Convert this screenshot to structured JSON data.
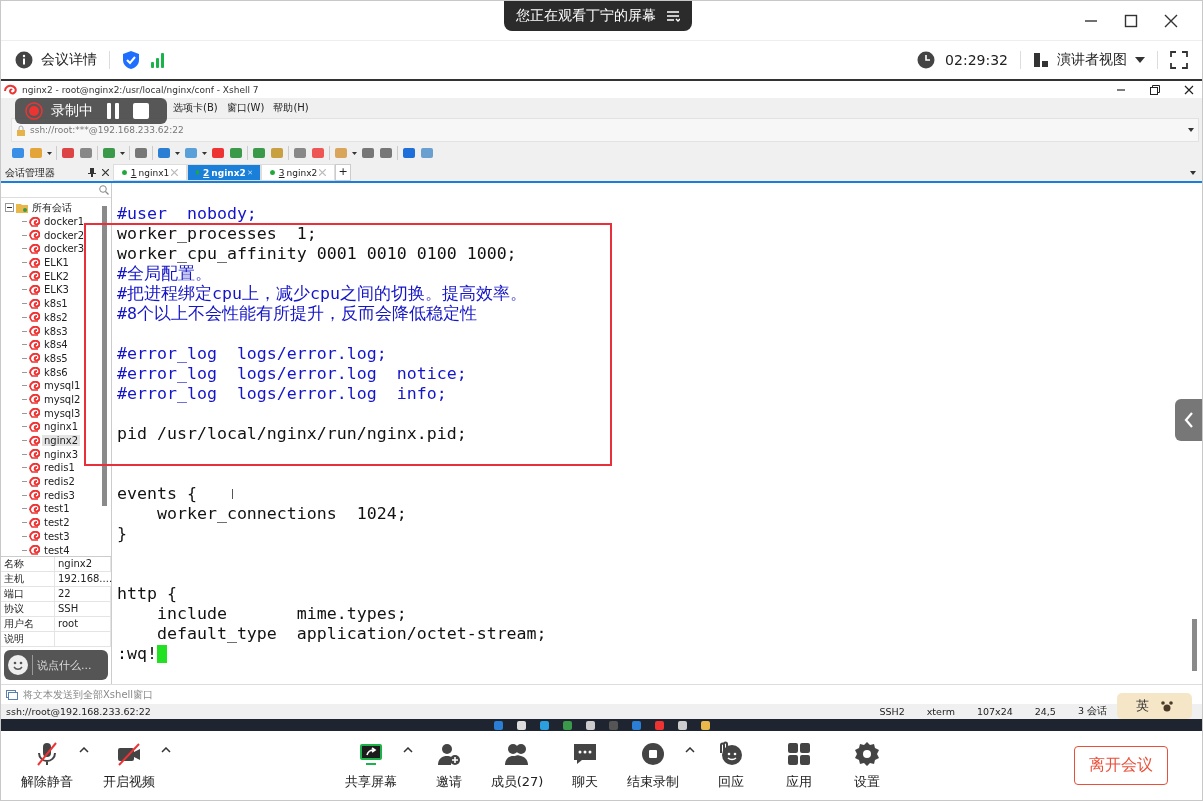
{
  "meeting_header": {
    "banner": "您正在观看丁宁的屏幕",
    "details": "会议详情",
    "timer": "02:29:32",
    "view": "演讲者视图"
  },
  "xshell": {
    "title": "nginx2 - root@nginx2:/usr/local/nginx/conf - Xshell 7",
    "menu": [
      "选项卡(B)",
      "窗口(W)",
      "帮助(H)"
    ],
    "address": "ssh://root:***@192.168.233.62:22",
    "session_panel": {
      "title": "会话管理器",
      "tree": {
        "label": "所有会话",
        "expanded": true,
        "children": [
          {
            "label": "docker1",
            "selected": false
          },
          {
            "label": "docker2",
            "selected": false
          },
          {
            "label": "docker3",
            "selected": false
          },
          {
            "label": "ELK1",
            "selected": false
          },
          {
            "label": "ELK2",
            "selected": false
          },
          {
            "label": "ELK3",
            "selected": false
          },
          {
            "label": "k8s1",
            "selected": false
          },
          {
            "label": "k8s2",
            "selected": false
          },
          {
            "label": "k8s3",
            "selected": false
          },
          {
            "label": "k8s4",
            "selected": false
          },
          {
            "label": "k8s5",
            "selected": false
          },
          {
            "label": "k8s6",
            "selected": false
          },
          {
            "label": "mysql1",
            "selected": false
          },
          {
            "label": "mysql2",
            "selected": false
          },
          {
            "label": "mysql3",
            "selected": false
          },
          {
            "label": "nginx1",
            "selected": false
          },
          {
            "label": "nginx2",
            "selected": true
          },
          {
            "label": "nginx3",
            "selected": false
          },
          {
            "label": "redis1",
            "selected": false
          },
          {
            "label": "redis2",
            "selected": false
          },
          {
            "label": "redis3",
            "selected": false
          },
          {
            "label": "test1",
            "selected": false
          },
          {
            "label": "test2",
            "selected": false
          },
          {
            "label": "test3",
            "selected": false
          },
          {
            "label": "test4",
            "selected": false
          }
        ]
      },
      "properties": [
        {
          "name": "名称",
          "value": "nginx2"
        },
        {
          "name": "主机",
          "value": "192.168...."
        },
        {
          "name": "端口",
          "value": "22"
        },
        {
          "name": "协议",
          "value": "SSH"
        },
        {
          "name": "用户名",
          "value": "root"
        },
        {
          "name": "说明"
        }
      ]
    },
    "tabs": [
      {
        "number": "1",
        "label": "nginx1",
        "selected": false,
        "connected": true
      },
      {
        "number": "2",
        "label": "nginx2",
        "selected": true,
        "connected": true
      },
      {
        "number": "3",
        "label": "nginx2",
        "selected": false,
        "connected": true
      }
    ],
    "new_tab": "+",
    "terminal": [
      {
        "kind": "comment",
        "text": "#user  nobody;"
      },
      {
        "kind": "code",
        "text": "worker_processes  1;"
      },
      {
        "kind": "code",
        "text": "worker_cpu_affinity 0001 0010 0100 1000;"
      },
      {
        "kind": "comment",
        "text": "#全局配置。"
      },
      {
        "kind": "comment",
        "text": "#把进程绑定cpu上，减少cpu之间的切换。提高效率。"
      },
      {
        "kind": "comment",
        "text": "#8个以上不会性能有所提升，反而会降低稳定性"
      },
      {
        "kind": "blank"
      },
      {
        "kind": "comment",
        "text": "#error_log  logs/error.log;"
      },
      {
        "kind": "comment",
        "text": "#error_log  logs/error.log  notice;"
      },
      {
        "kind": "comment",
        "text": "#error_log  logs/error.log  info;"
      },
      {
        "kind": "blank"
      },
      {
        "kind": "code",
        "text": "pid /usr/local/nginx/run/nginx.pid;"
      },
      {
        "kind": "blank"
      },
      {
        "kind": "blank"
      },
      {
        "kind": "code",
        "text": "events {"
      },
      {
        "kind": "code",
        "text": "    worker_connections  1024;"
      },
      {
        "kind": "code",
        "text": "}"
      },
      {
        "kind": "blank"
      },
      {
        "kind": "blank"
      },
      {
        "kind": "code",
        "text": "http {"
      },
      {
        "kind": "code",
        "text": "    include       mime.types;"
      },
      {
        "kind": "code",
        "text": "    default_type  application/octet-stream;"
      },
      {
        "kind": "code",
        "text": ":wq!",
        "cursor": true
      }
    ],
    "send_bar": "将文本发送到全部Xshell窗口",
    "status": {
      "connection": "ssh://root@192.168.233.62:22",
      "items": [
        "SSH2",
        "xterm",
        "107x24",
        "24,5",
        "3 会话"
      ]
    }
  },
  "recording": {
    "label": "录制中"
  },
  "chat_input": {
    "placeholder": "说点什么..."
  },
  "ime": {
    "label": "英"
  },
  "toolbar": [
    {
      "kind": "mic",
      "label": "解除静音",
      "menu": true
    },
    {
      "kind": "video",
      "label": "开启视频",
      "menu": true
    },
    {
      "kind": "share",
      "label": "共享屏幕",
      "menu": true
    },
    {
      "kind": "invite",
      "label": "邀请",
      "menu": false
    },
    {
      "kind": "members",
      "label": "成员(27)",
      "menu": false
    },
    {
      "kind": "chat",
      "label": "聊天",
      "menu": false
    },
    {
      "kind": "record",
      "label": "结束录制",
      "menu": true
    },
    {
      "kind": "react",
      "label": "回应",
      "menu": false
    },
    {
      "kind": "apps",
      "label": "应用",
      "menu": false
    },
    {
      "kind": "settings",
      "label": "设置",
      "menu": false
    }
  ],
  "leave_button": "离开会议"
}
